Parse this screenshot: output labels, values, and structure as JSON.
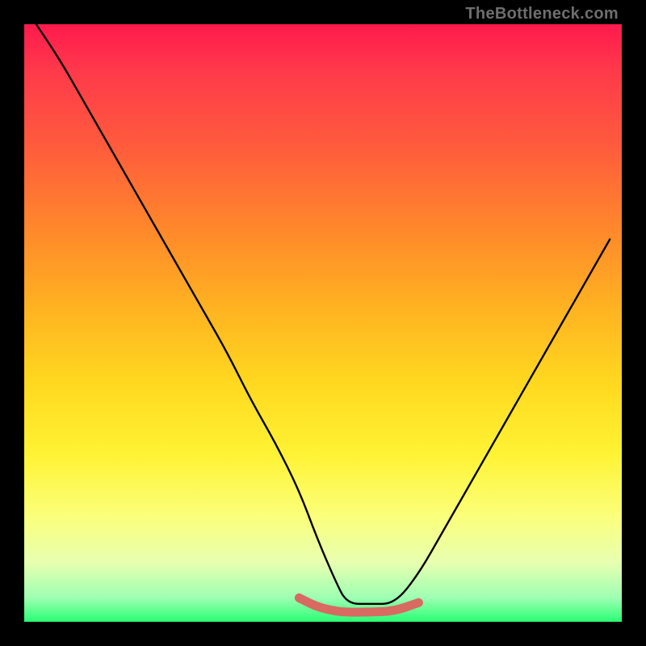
{
  "watermark": "TheBottleneck.com",
  "chart_data": {
    "type": "line",
    "title": "",
    "xlabel": "",
    "ylabel": "",
    "xlim": [
      0,
      100
    ],
    "ylim": [
      0,
      100
    ],
    "grid": false,
    "legend": false,
    "series": [
      {
        "name": "curve-main-black",
        "color": "#000000",
        "x": [
          2,
          6,
          10,
          14,
          18,
          22,
          26,
          30,
          34,
          38,
          42,
          46,
          49,
          52,
          54,
          58,
          62,
          66,
          70,
          74,
          78,
          82,
          86,
          90,
          94,
          98
        ],
        "values": [
          100,
          94,
          87,
          80,
          73,
          66,
          59,
          52,
          45,
          37,
          30,
          22,
          14,
          7,
          3,
          3,
          3,
          8,
          15,
          22,
          29,
          36,
          43,
          50,
          57,
          64
        ]
      },
      {
        "name": "flat-highlight-coral",
        "color": "#d86a62",
        "x": [
          46,
          49,
          52,
          54,
          58,
          62,
          66
        ],
        "values": [
          4,
          2.5,
          1.8,
          1.6,
          1.6,
          1.8,
          3.2
        ]
      }
    ],
    "annotations": []
  }
}
